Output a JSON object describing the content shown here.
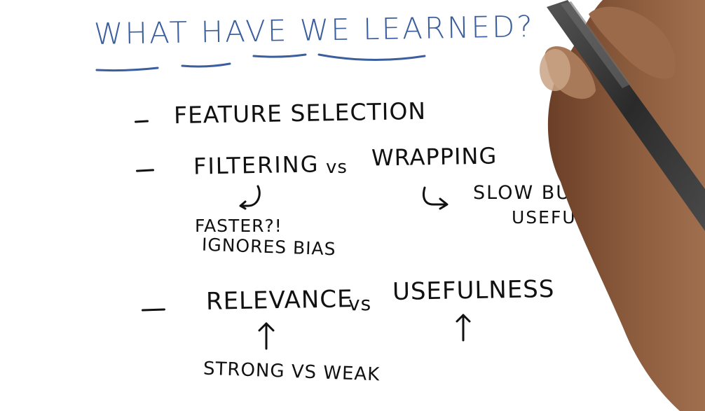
{
  "title": "What Have We Learned?",
  "items": {
    "feature_selection": "Feature Selection",
    "filtering": "Filtering",
    "vs_1": "vs",
    "wrapping": "Wrapping",
    "slow_but": "Slow But",
    "useful": "Useful",
    "faster": "Faster?!",
    "ignores_bias": "Ignores Bias",
    "relevance": "Relevance",
    "vs_2": "vs",
    "usefulness": "Usefulness",
    "strong_vs_weak": "Strong vs Weak"
  },
  "colors": {
    "title_ink": "#3b5f9e",
    "ink": "#111111",
    "background": "#ffffff",
    "skin": "#8a5a3c",
    "pen": "#3a3a3a"
  },
  "icons": [
    "hook-arrow-icon",
    "curved-arrow-icon",
    "up-arrow-icon",
    "up-arrow-icon",
    "hand-holding-pen-icon"
  ]
}
